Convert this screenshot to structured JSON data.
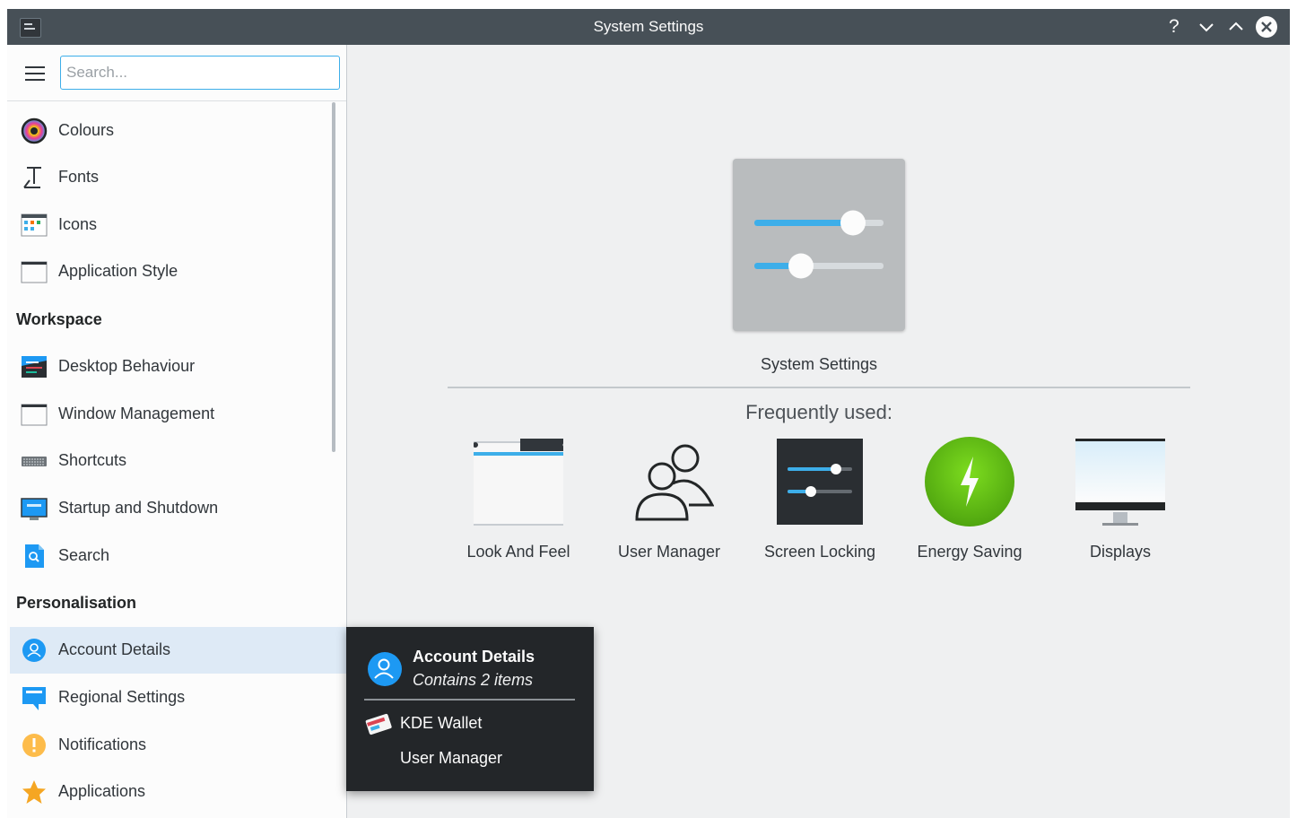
{
  "window": {
    "title": "System Settings"
  },
  "titlebar": {
    "help_glyph": "?",
    "minimize_icon": "chevron-down-icon",
    "maximize_icon": "chevron-up-icon",
    "close_icon": "close-icon"
  },
  "search": {
    "placeholder": "Search..."
  },
  "sidebar": {
    "items": [
      {
        "label": "Colours",
        "icon": "colours-icon"
      },
      {
        "label": "Fonts",
        "icon": "fonts-icon"
      },
      {
        "label": "Icons",
        "icon": "icons-icon"
      },
      {
        "label": "Application Style",
        "icon": "application-style-icon"
      }
    ],
    "workspace": {
      "heading": "Workspace",
      "items": [
        {
          "label": "Desktop Behaviour",
          "icon": "desktop-behaviour-icon"
        },
        {
          "label": "Window Management",
          "icon": "window-management-icon"
        },
        {
          "label": "Shortcuts",
          "icon": "keyboard-icon"
        },
        {
          "label": "Startup and Shutdown",
          "icon": "startup-shutdown-icon"
        },
        {
          "label": "Search",
          "icon": "search-icon"
        }
      ]
    },
    "personalisation": {
      "heading": "Personalisation",
      "items": [
        {
          "label": "Account Details",
          "icon": "user-icon",
          "selected": true
        },
        {
          "label": "Regional Settings",
          "icon": "regional-settings-icon"
        },
        {
          "label": "Notifications",
          "icon": "notifications-icon"
        },
        {
          "label": "Applications",
          "icon": "star-icon"
        }
      ]
    }
  },
  "main": {
    "hero_label": "System Settings",
    "frequently_used_label": "Frequently used:",
    "favourites": [
      {
        "label": "Look And Feel",
        "icon": "look-and-feel-icon"
      },
      {
        "label": "User Manager",
        "icon": "user-manager-icon"
      },
      {
        "label": "Screen Locking",
        "icon": "screen-locking-icon"
      },
      {
        "label": "Energy Saving",
        "icon": "energy-saving-icon"
      },
      {
        "label": "Displays",
        "icon": "displays-icon"
      }
    ]
  },
  "tooltip": {
    "title": "Account Details",
    "subtitle": "Contains 2 items",
    "items": [
      "KDE Wallet",
      "User Manager"
    ]
  },
  "colors": {
    "accent": "#3daee9",
    "titlebar": "#475057",
    "selection": "#deeaf6",
    "tooltip_bg": "#232629"
  }
}
